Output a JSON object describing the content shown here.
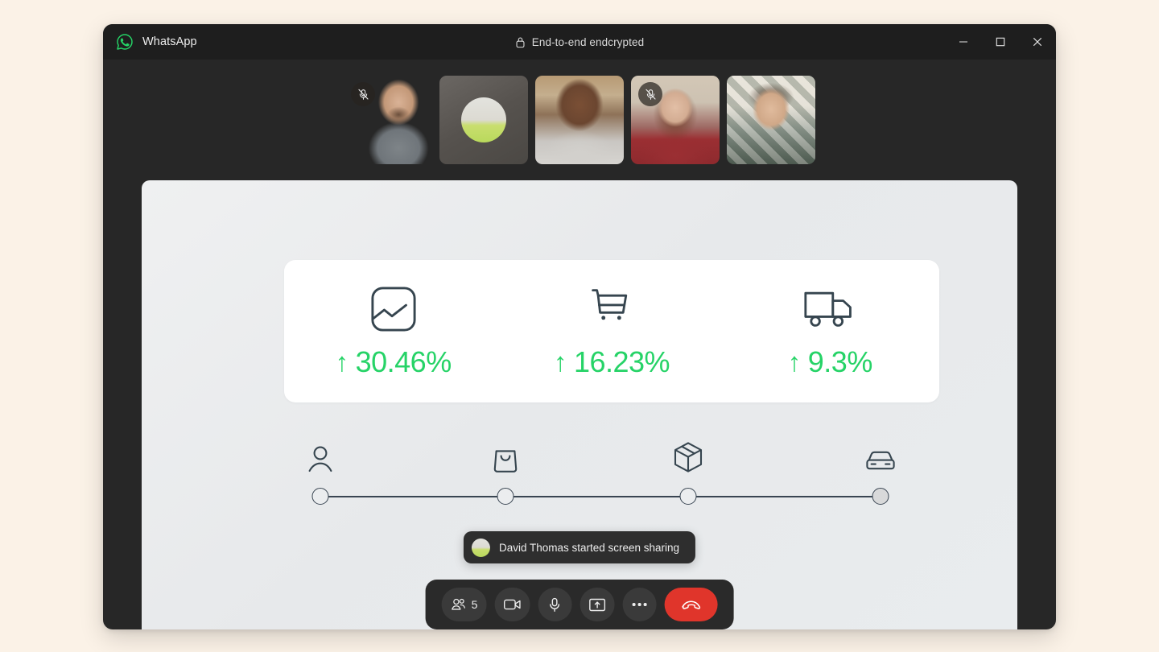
{
  "window": {
    "app_name": "WhatsApp",
    "encryption_label": "End-to-end endcrypted",
    "logo_icon": "whatsapp-logo-icon",
    "lock_icon": "lock-icon",
    "controls": {
      "minimize": "minimize-icon",
      "maximize": "maximize-icon",
      "close": "close-icon"
    },
    "accent_green": "#25D366",
    "titlebar_bg": "#1E1E1E",
    "window_bg": "#272727",
    "page_bg": "#FBF2E7"
  },
  "filmstrip": {
    "participants": [
      {
        "name": "participant-1",
        "kind": "video",
        "muted": true,
        "mute_icon": "mic-muted-icon"
      },
      {
        "name": "participant-2",
        "kind": "avatar",
        "muted": false,
        "mute_icon": ""
      },
      {
        "name": "participant-3",
        "kind": "video",
        "muted": false,
        "mute_icon": ""
      },
      {
        "name": "participant-4",
        "kind": "video",
        "muted": true,
        "mute_icon": "mic-muted-icon"
      },
      {
        "name": "participant-5",
        "kind": "video",
        "muted": false,
        "mute_icon": ""
      }
    ]
  },
  "shared_screen": {
    "stats": [
      {
        "icon": "image-chart-icon",
        "direction": "up",
        "arrow": "↑",
        "value": "30.46%"
      },
      {
        "icon": "shopping-cart-icon",
        "direction": "up",
        "arrow": "↑",
        "value": "16.23%"
      },
      {
        "icon": "delivery-truck-icon",
        "direction": "up",
        "arrow": "↑",
        "value": "9.3%"
      }
    ],
    "stat_color": "#26D367",
    "tracker": {
      "steps": [
        {
          "icon": "user-icon",
          "filled": false
        },
        {
          "icon": "shopping-bag-icon",
          "filled": false
        },
        {
          "icon": "package-box-icon",
          "filled": false
        },
        {
          "icon": "car-icon",
          "filled": true
        }
      ],
      "line_color": "#394552"
    }
  },
  "toast": {
    "avatar": "david-thomas-avatar",
    "message": "David Thomas started screen sharing"
  },
  "call_controls": {
    "participants": {
      "icon": "people-icon",
      "count": "5"
    },
    "camera": {
      "icon": "video-camera-icon"
    },
    "microphone": {
      "icon": "microphone-icon"
    },
    "share_screen": {
      "icon": "share-screen-icon"
    },
    "more": {
      "icon": "more-options-icon"
    },
    "end_call": {
      "icon": "end-call-icon",
      "color": "#E0352B"
    }
  }
}
